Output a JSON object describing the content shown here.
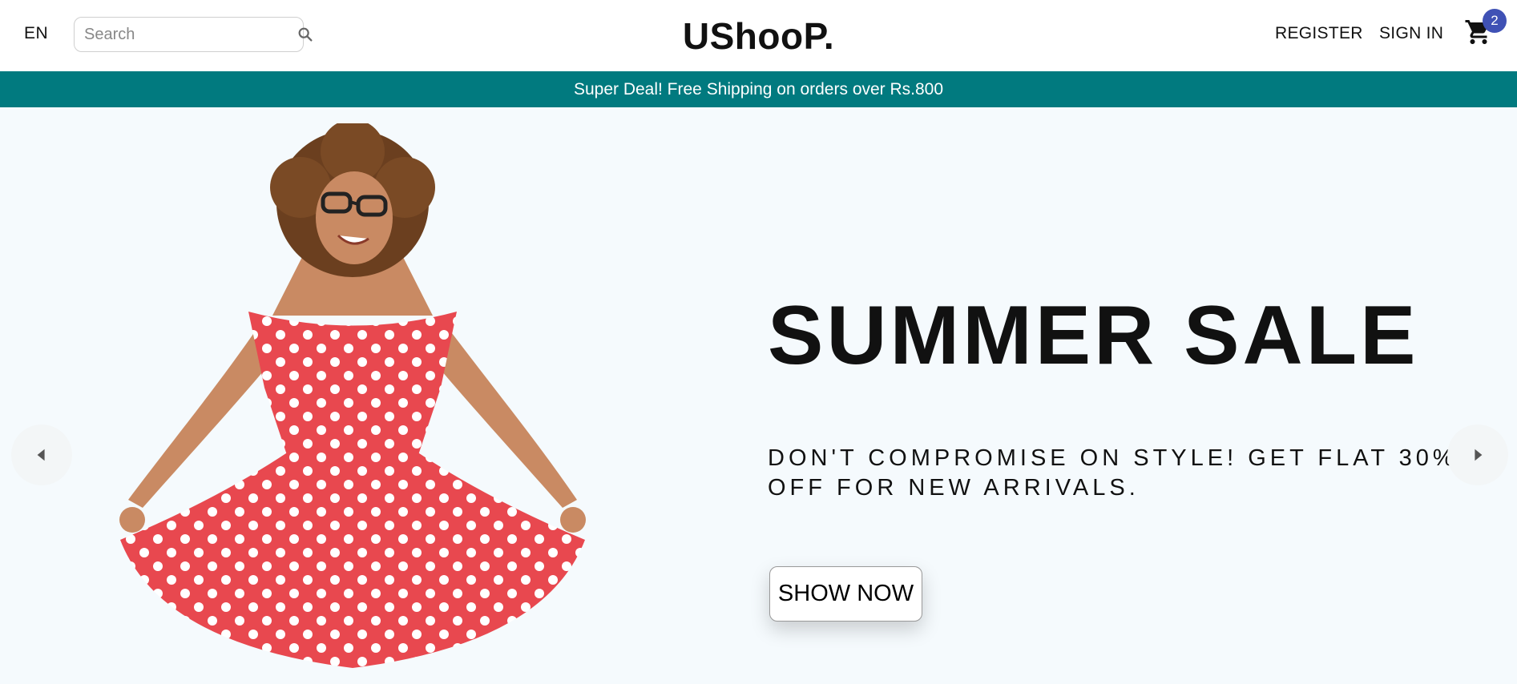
{
  "header": {
    "language": "EN",
    "search": {
      "placeholder": "Search"
    },
    "logo": "UShooP.",
    "menu": {
      "register": "REGISTER",
      "sign_in": "SIGN IN"
    },
    "cart": {
      "count": "2",
      "icon": "shopping-cart-icon"
    }
  },
  "announcement": "Super Deal! Free Shipping on orders over Rs.800",
  "slide": {
    "title": "SUMMER SALE",
    "description": "DON'T COMPROMISE ON STYLE! GET FLAT 30% OFF FOR NEW ARRIVALS.",
    "button": "SHOW NOW",
    "image": "woman-in-polka-dot-dress"
  },
  "colors": {
    "announcement_bg": "#017a7f",
    "slide_bg": "#f5fafd",
    "badge_bg": "#3f51b5",
    "dress_red": "#e8484f"
  }
}
